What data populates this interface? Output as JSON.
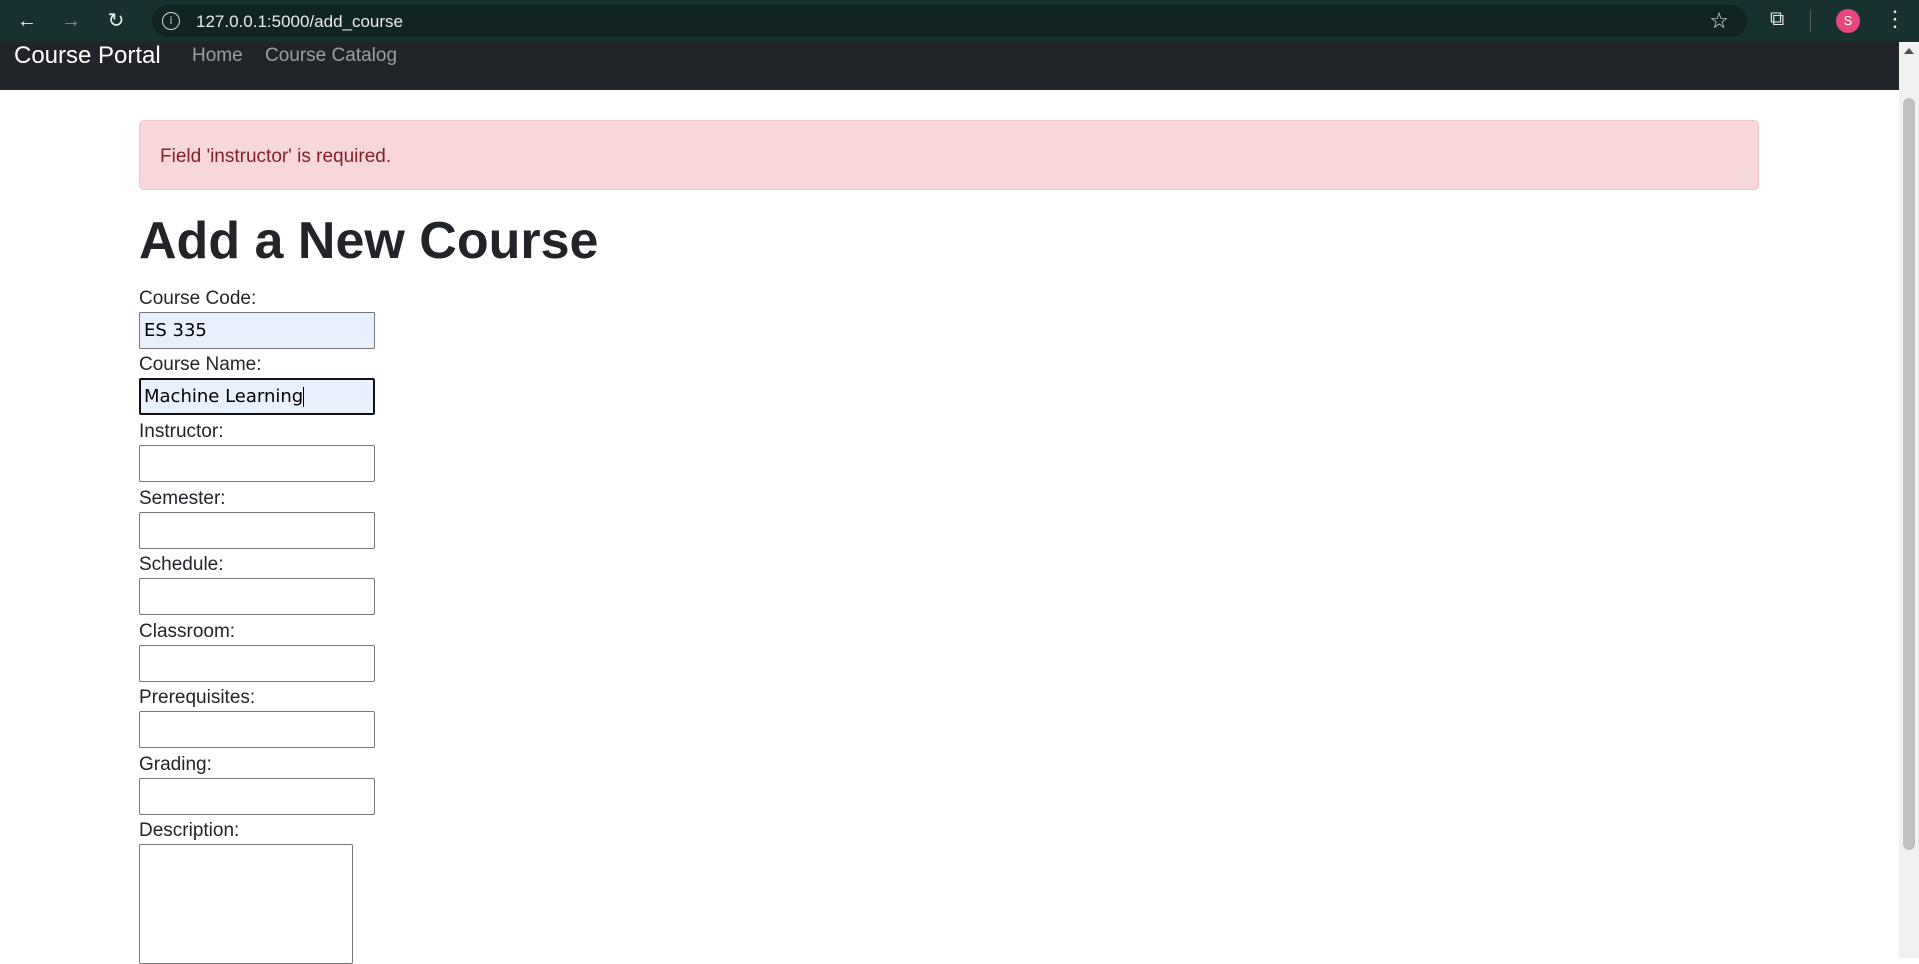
{
  "browser": {
    "url": "127.0.0.1:5000/add_course",
    "avatar_letter": "S",
    "icons": {
      "back": "back-arrow-icon",
      "forward": "forward-arrow-icon",
      "reload": "reload-icon",
      "info": "site-info-icon",
      "bookmark": "star-icon",
      "extensions": "puzzle-icon",
      "menu": "kebab-menu-icon"
    }
  },
  "navbar": {
    "brand": "Course Portal",
    "links": [
      "Home",
      "Course Catalog"
    ]
  },
  "alert": {
    "message": "Field 'instructor' is required.",
    "color_bg": "#f8d7da",
    "color_text": "#842029"
  },
  "page_title": "Add a New Course",
  "form": {
    "fields": [
      {
        "label": "Course Code:",
        "value": "ES 335"
      },
      {
        "label": "Course Name:",
        "value": "Machine Learning"
      },
      {
        "label": "Instructor:",
        "value": ""
      },
      {
        "label": "Semester:",
        "value": ""
      },
      {
        "label": "Schedule:",
        "value": ""
      },
      {
        "label": "Classroom:",
        "value": ""
      },
      {
        "label": "Prerequisites:",
        "value": ""
      },
      {
        "label": "Grading:",
        "value": ""
      }
    ],
    "description_label": "Description:",
    "description_value": ""
  }
}
